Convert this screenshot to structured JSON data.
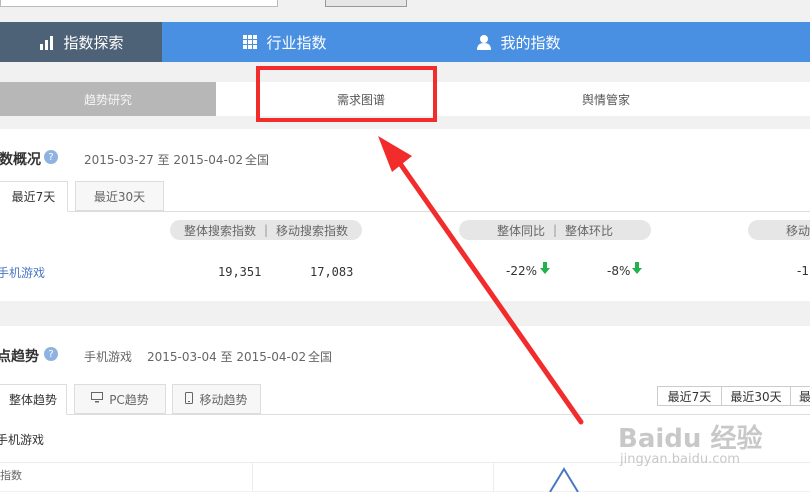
{
  "nav": {
    "items": [
      {
        "label": "指数探索",
        "icon": "bar-chart-icon"
      },
      {
        "label": "行业指数",
        "icon": "grid-icon"
      },
      {
        "label": "我的指数",
        "icon": "user-icon"
      }
    ]
  },
  "subtabs": [
    "趋势研究",
    "需求图谱",
    "舆情管家"
  ],
  "overview": {
    "title": "数概况",
    "date_range": "2015-03-27 至 2015-04-02",
    "region": "全国",
    "tabs": [
      "最近7天",
      "最近30天"
    ],
    "pill_search": {
      "a": "整体搜索指数",
      "b": "移动搜索指数"
    },
    "pill_ratio": {
      "a": "整体同比",
      "b": "整体环比"
    },
    "pill_mobile": "移动",
    "row": {
      "keyword": "手机游戏",
      "overall": "19,351",
      "mobile": "17,083",
      "yoy": "-22%",
      "mom": "-8%",
      "right_partial": "-1"
    }
  },
  "trend": {
    "title": "点趋势",
    "keyword": "手机游戏",
    "date_range": "2015-03-04 至 2015-04-02",
    "region": "全国",
    "tabs": [
      "整体趋势",
      "PC趋势",
      "移动趋势"
    ],
    "ranges": [
      "最近7天",
      "最近30天",
      "最"
    ],
    "legend_keyword": "手机游戏",
    "axis_label": "指数"
  },
  "watermark": {
    "brand": "Baidu 经验",
    "url": "jingyan.baidu.com"
  },
  "colors": {
    "nav_blue": "#4a90e2",
    "nav_active": "#4d6177",
    "highlight_red": "#f22b2b",
    "down_green": "#22b14c",
    "link_blue": "#4a78c2"
  }
}
